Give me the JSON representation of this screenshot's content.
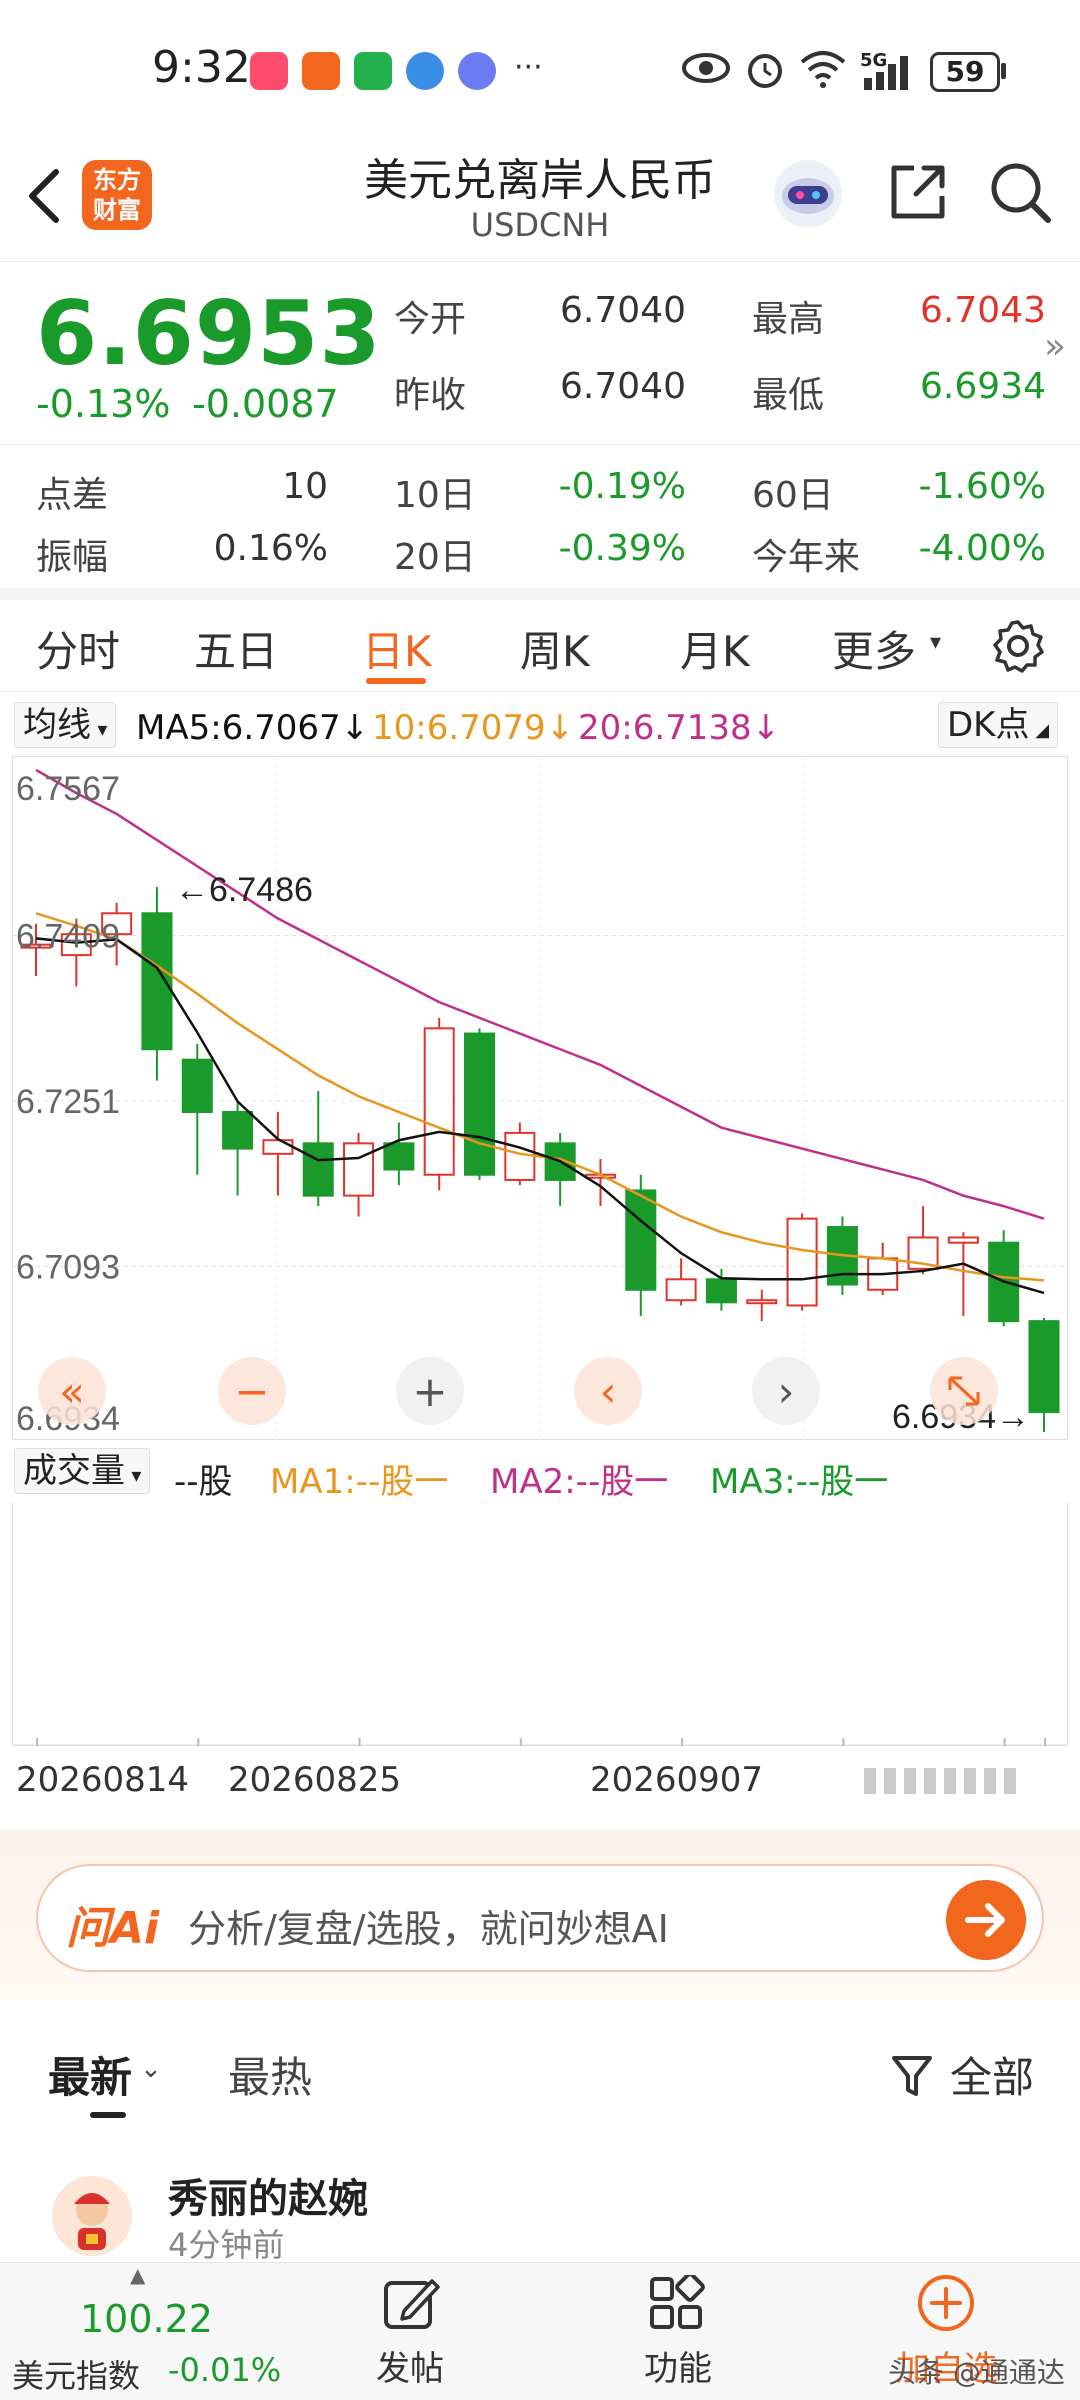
{
  "status_bar": {
    "time": "9:32",
    "more": "···",
    "network": "5G",
    "battery": "59"
  },
  "header": {
    "back_icon": "chevron-left-icon",
    "logo_line1": "东方",
    "logo_line2": "财富",
    "title": "美元兑离岸人民币",
    "subtitle": "USDCNH",
    "share_icon": "share-icon",
    "search_icon": "search-icon"
  },
  "quote": {
    "price": "6.6953",
    "change_pct": "-0.13%",
    "change_abs": "-0.0087",
    "open_label": "今开",
    "open": "6.7040",
    "high_label": "最高",
    "high": "6.7043",
    "prev_close_label": "昨收",
    "prev_close": "6.7040",
    "low_label": "最低",
    "low": "6.6934",
    "spread_label": "点差",
    "spread": "10",
    "d10_label": "10日",
    "d10": "-0.19%",
    "d60_label": "60日",
    "d60": "-1.60%",
    "amplitude_label": "振幅",
    "amplitude": "0.16%",
    "d20_label": "20日",
    "d20": "-0.39%",
    "ytd_label": "今年来",
    "ytd": "-4.00%",
    "expand": "»"
  },
  "tabs": [
    "分时",
    "五日",
    "日K",
    "周K",
    "月K",
    "更多"
  ],
  "active_tab": "日K",
  "ma_legend": {
    "selector": "均线",
    "ma5": "MA5:6.7067",
    "ma10": "10:6.7079",
    "ma20": "20:6.7138",
    "arrow": "↓",
    "dk_button": "DK点"
  },
  "colors": {
    "up": "#e0342a",
    "down": "#1a9a2a",
    "ma5": "#111111",
    "ma10": "#e8961e",
    "ma20": "#c0308a",
    "accent": "#f2661e"
  },
  "chart_data": {
    "type": "candlestick",
    "y_labels": [
      "6.7567",
      "6.7409",
      "6.7251",
      "6.7093",
      "6.6934"
    ],
    "ylim": [
      6.6934,
      6.7567
    ],
    "max_label": "6.7486",
    "min_label": "6.6934",
    "candles": [
      {
        "o": 6.74,
        "c": 6.74,
        "h": 6.742,
        "l": 6.737
      },
      {
        "o": 6.739,
        "c": 6.741,
        "h": 6.7425,
        "l": 6.736
      },
      {
        "o": 6.741,
        "c": 6.743,
        "h": 6.744,
        "l": 6.738
      },
      {
        "o": 6.743,
        "c": 6.73,
        "h": 6.7455,
        "l": 6.727
      },
      {
        "o": 6.729,
        "c": 6.724,
        "h": 6.7305,
        "l": 6.718
      },
      {
        "o": 6.724,
        "c": 6.7205,
        "h": 6.725,
        "l": 6.716
      },
      {
        "o": 6.72,
        "c": 6.7213,
        "h": 6.724,
        "l": 6.716
      },
      {
        "o": 6.721,
        "c": 6.716,
        "h": 6.726,
        "l": 6.715
      },
      {
        "o": 6.716,
        "c": 6.721,
        "h": 6.722,
        "l": 6.714
      },
      {
        "o": 6.721,
        "c": 6.7185,
        "h": 6.723,
        "l": 6.717
      },
      {
        "o": 6.718,
        "c": 6.732,
        "h": 6.733,
        "l": 6.7165
      },
      {
        "o": 6.7315,
        "c": 6.718,
        "h": 6.732,
        "l": 6.7175
      },
      {
        "o": 6.7175,
        "c": 6.722,
        "h": 6.723,
        "l": 6.717
      },
      {
        "o": 6.721,
        "c": 6.7175,
        "h": 6.722,
        "l": 6.715
      },
      {
        "o": 6.718,
        "c": 6.718,
        "h": 6.7195,
        "l": 6.715
      },
      {
        "o": 6.7165,
        "c": 6.707,
        "h": 6.718,
        "l": 6.7045
      },
      {
        "o": 6.706,
        "c": 6.708,
        "h": 6.71,
        "l": 6.7055
      },
      {
        "o": 6.708,
        "c": 6.7058,
        "h": 6.709,
        "l": 6.705
      },
      {
        "o": 6.706,
        "c": 6.706,
        "h": 6.707,
        "l": 6.704
      },
      {
        "o": 6.7055,
        "c": 6.7138,
        "h": 6.7143,
        "l": 6.705
      },
      {
        "o": 6.713,
        "c": 6.7075,
        "h": 6.714,
        "l": 6.7065
      },
      {
        "o": 6.707,
        "c": 6.71,
        "h": 6.7115,
        "l": 6.7065
      },
      {
        "o": 6.709,
        "c": 6.712,
        "h": 6.715,
        "l": 6.7085
      },
      {
        "o": 6.7115,
        "c": 6.712,
        "h": 6.7125,
        "l": 6.7045
      },
      {
        "o": 6.7115,
        "c": 6.704,
        "h": 6.7127,
        "l": 6.7035
      },
      {
        "o": 6.704,
        "c": 6.6953,
        "h": 6.7043,
        "l": 6.6934
      }
    ],
    "ma5": [
      6.7406,
      6.7402,
      6.7405,
      6.7378,
      6.7316,
      6.725,
      6.7214,
      6.7194,
      6.7196,
      6.7213,
      6.7221,
      6.7216,
      6.7206,
      6.7193,
      6.7169,
      6.7136,
      6.7105,
      6.7081,
      6.708,
      6.708,
      6.7085,
      6.7085,
      6.7088,
      6.7095,
      6.7078,
      6.7067
    ],
    "ma10": [
      6.743,
      6.7418,
      6.7405,
      6.738,
      6.7353,
      6.7325,
      6.73,
      6.7275,
      6.7255,
      6.724,
      6.7225,
      6.721,
      6.72,
      6.7195,
      6.718,
      6.716,
      6.714,
      6.7125,
      6.7115,
      6.7108,
      6.7103,
      6.71,
      6.7095,
      6.7088,
      6.7082,
      6.7079
    ],
    "ma20": [
      6.7567,
      6.7545,
      6.7525,
      6.75,
      6.7475,
      6.745,
      6.7425,
      6.7405,
      6.7385,
      6.7365,
      6.7345,
      6.733,
      6.7315,
      6.73,
      6.7285,
      6.7265,
      6.7245,
      6.7225,
      6.7215,
      6.7205,
      6.7195,
      6.7185,
      6.7175,
      6.716,
      6.715,
      6.7138
    ]
  },
  "chart_controls": [
    "«",
    "−",
    "+",
    "‹",
    "›"
  ],
  "volume": {
    "selector": "成交量",
    "unit": "--股",
    "ma1": "MA1:--股一",
    "ma2": "MA2:--股一",
    "ma3": "MA3:--股一"
  },
  "dates": [
    "20260814",
    "20260825",
    "20260907"
  ],
  "ai": {
    "logo": "问Ai",
    "placeholder": "分析/复盘/选股，就问妙想AI"
  },
  "feed": {
    "tab_latest": "最新",
    "tab_hot": "最热",
    "filter": "全部",
    "post_name": "秀丽的赵婉",
    "post_time": "4分钟前"
  },
  "bottom_nav": {
    "index_value": "100.22",
    "index_name": "美元指数",
    "index_change": "-0.01%",
    "post": "发帖",
    "function": "功能",
    "add": "加自选",
    "watermark": "头条 @通通达"
  }
}
